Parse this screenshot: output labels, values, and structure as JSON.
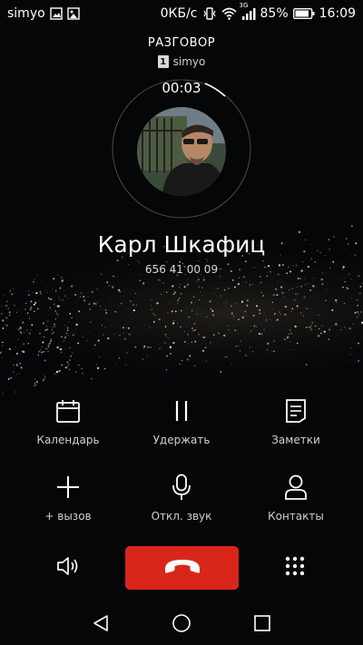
{
  "status_bar": {
    "carrier": "simyo",
    "data_speed": "0КБ/с",
    "network_type": "3G",
    "battery": "85%",
    "time": "16:09"
  },
  "call": {
    "state": "РАЗГОВОР",
    "sim_number": "1",
    "sim_carrier": "simyo",
    "timer": "00:03",
    "contact_name": "Карл Шкафиц",
    "contact_number": "656 41 00 09"
  },
  "actions": {
    "calendar": "Календарь",
    "hold": "Удержать",
    "notes": "Заметки",
    "add_call": "+ вызов",
    "mute": "Откл. звук",
    "contacts": "Контакты"
  },
  "colors": {
    "end_call": "#d9261b",
    "background": "#050608"
  },
  "icons": [
    "speaker-icon",
    "end-call-icon",
    "dialpad-icon",
    "back-icon",
    "home-icon",
    "recents-icon"
  ]
}
